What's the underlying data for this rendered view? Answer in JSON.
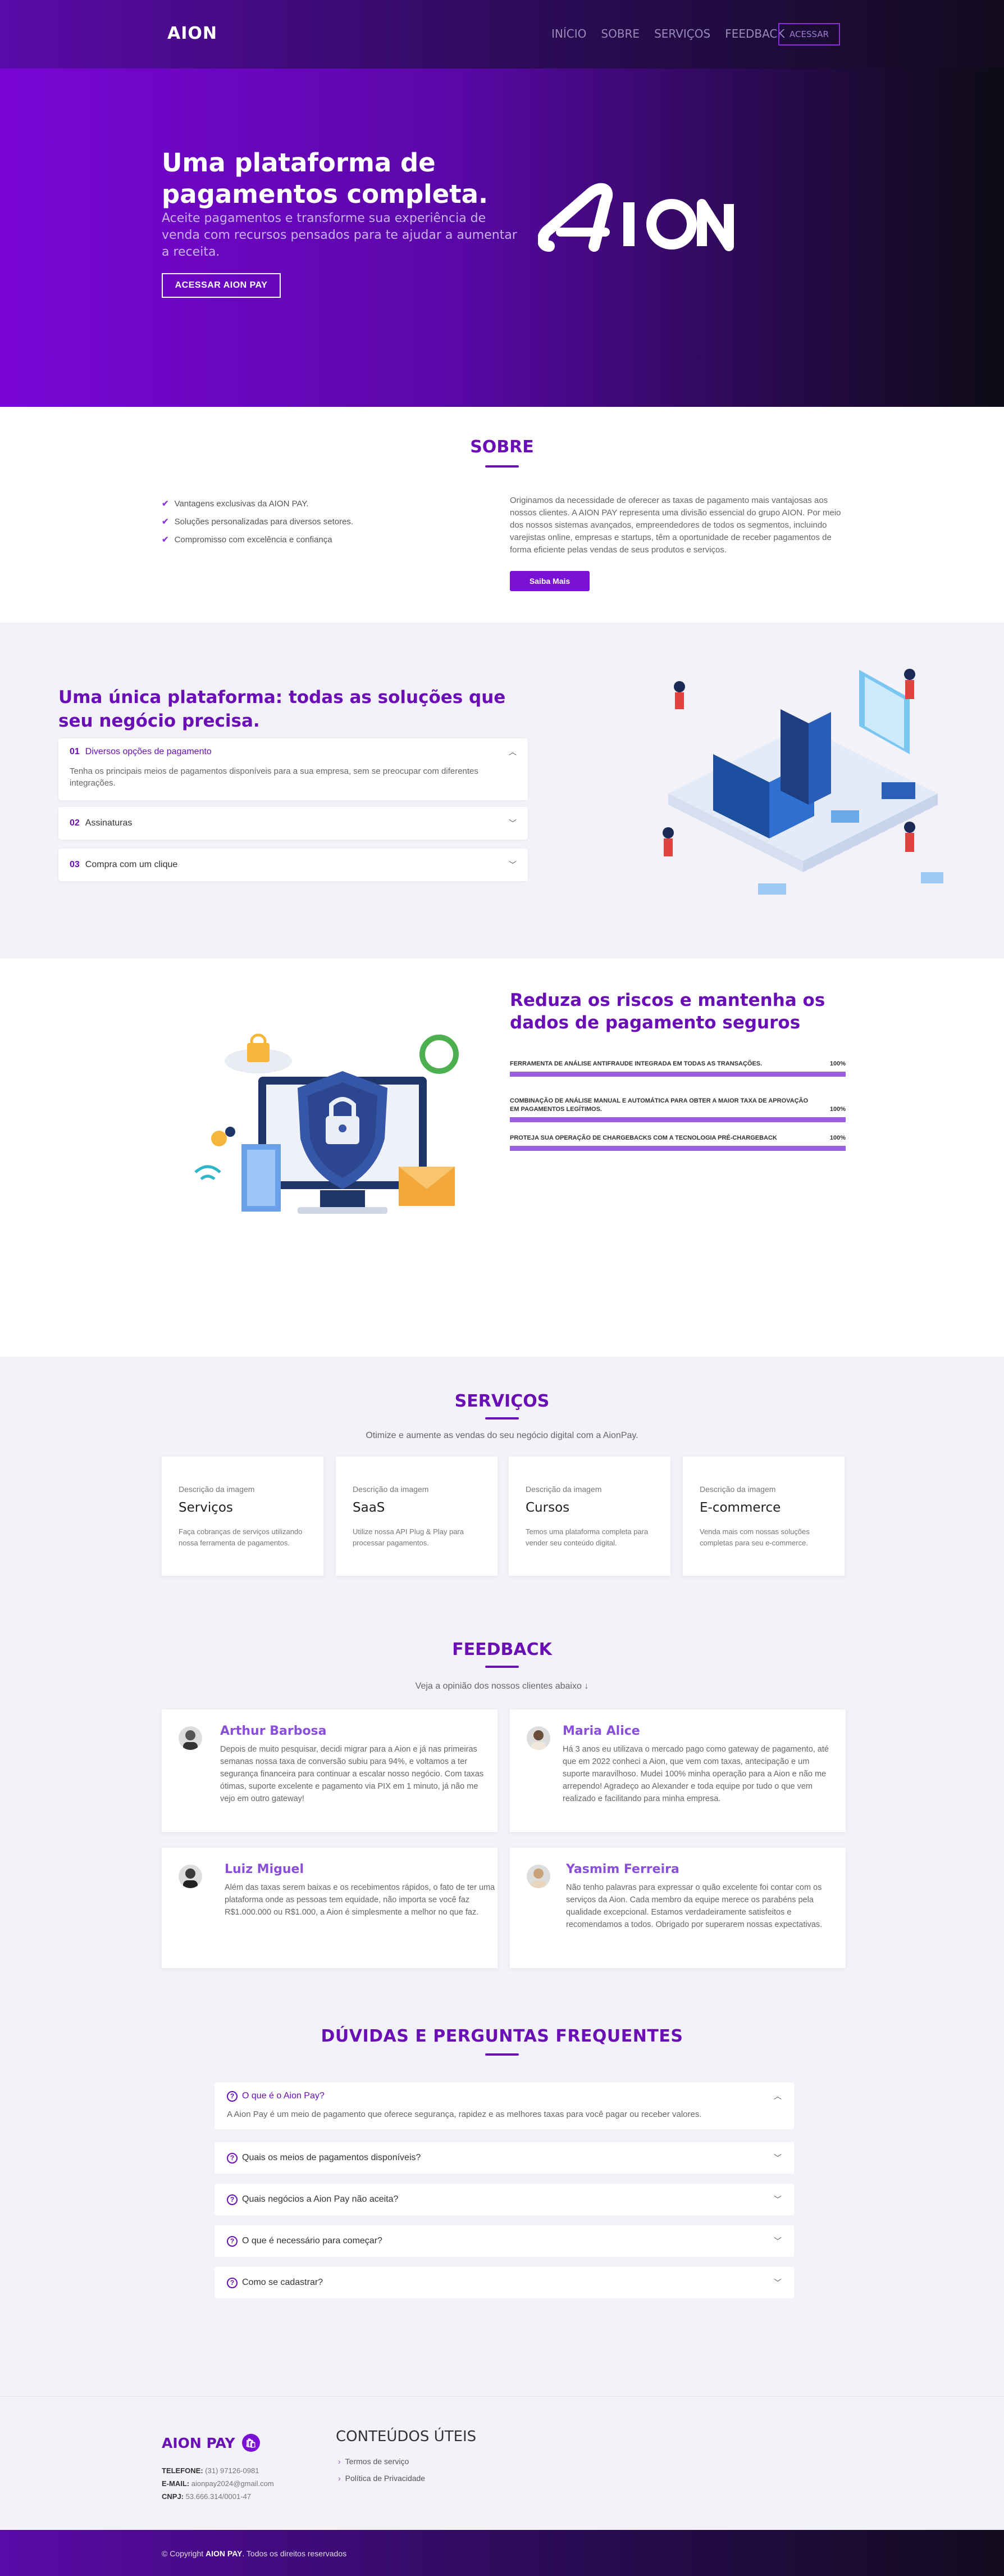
{
  "nav": {
    "logo": "AION",
    "links": [
      "INÍCIO",
      "SOBRE",
      "SERVIÇOS",
      "FEEDBACK"
    ],
    "cta": "ACESSAR"
  },
  "hero": {
    "title": "Uma plataforma de pagamentos completa.",
    "subtitle": "Aceite pagamentos e transforme sua experiência de venda com recursos pensados para te ajudar a aumentar a receita.",
    "button": "ACESSAR AION PAY",
    "logo": "AION"
  },
  "sobre": {
    "title": "SOBRE",
    "checks": [
      "Vantagens exclusivas da AION PAY.",
      "Soluções personalizadas para diversos setores.",
      "Compromisso com excelência e confiança"
    ],
    "text": "Originamos da necessidade de oferecer as taxas de pagamento mais vantajosas aos nossos clientes. A AION PAY representa uma divisão essencial do grupo AION. Por meio dos nossos sistemas avançados, empreendedores de todos os segmentos, incluindo varejistas online, empresas e startups, têm a oportunidade de receber pagamentos de forma eficiente pelas vendas de seus produtos e serviços.",
    "button": "Saiba Mais"
  },
  "plataforma": {
    "title": "Uma única plataforma: todas as soluções que seu negócio precisa.",
    "items": [
      {
        "num": "01",
        "label": "Diversos opções de pagamento",
        "body": "Tenha os principais meios de pagamentos disponíveis para a sua empresa, sem se preocupar com diferentes integrações."
      },
      {
        "num": "02",
        "label": "Assinaturas"
      },
      {
        "num": "03",
        "label": "Compra com um clique"
      }
    ]
  },
  "riscos": {
    "title": "Reduza os riscos e mantenha os dados de pagamento seguros",
    "bars": [
      {
        "label": "FERRAMENTA DE ANÁLISE ANTIFRAUDE INTEGRADA EM TODAS AS TRANSAÇÕES.",
        "value": "100%",
        "pct": 100
      },
      {
        "label": "COMBINAÇÃO DE ANÁLISE MANUAL E AUTOMÁTICA PARA OBTER A MAIOR TAXA DE APROVAÇÃO EM PAGAMENTOS LEGÍTIMOS.",
        "value": "100%",
        "pct": 100
      },
      {
        "label": "PROTEJA SUA OPERAÇÃO DE CHARGEBACKS COM A TECNOLOGIA PRÉ-CHARGEBACK",
        "value": "100%",
        "pct": 100
      }
    ]
  },
  "servicos": {
    "title": "SERVIÇOS",
    "subtitle": "Otimize e aumente as vendas do seu negócio digital com a AionPay.",
    "img_alt": "Descrição da imagem",
    "cards": [
      {
        "name": "Serviços",
        "desc": "Faça cobranças de serviços utilizando nossa ferramenta de pagamentos."
      },
      {
        "name": "SaaS",
        "desc": "Utilize nossa API Plug & Play para processar pagamentos."
      },
      {
        "name": "Cursos",
        "desc": "Temos uma plataforma completa para vender seu conteúdo digital."
      },
      {
        "name": "E-commerce",
        "desc": "Venda mais com nossas soluções completas para seu e-commerce."
      }
    ]
  },
  "feedback": {
    "title": "FEEDBACK",
    "subtitle": "Veja a opinião dos nossos clientes abaixo ↓",
    "items": [
      {
        "name": "Arthur Barbosa",
        "text": "Depois de muito pesquisar, decidi migrar para a Aion e já nas primeiras semanas nossa taxa de conversão subiu para 94%, e voltamos a ter segurança financeira para continuar a escalar nosso negócio. Com taxas ótimas, suporte excelente e pagamento via PIX em 1 minuto, já não me vejo em outro gateway!"
      },
      {
        "name": "Maria Alice",
        "text": "Há 3 anos eu utilizava o mercado pago como gateway de pagamento, até que em 2022 conheci a Aion, que vem com taxas, antecipação e um suporte maravilhoso. Mudei 100% minha operação para a Aion e não me arrependo! Agradeço ao Alexander e toda equipe por tudo o que vem realizado e facilitando para minha empresa."
      },
      {
        "name": "Luiz Miguel",
        "text": "Além das taxas serem baixas e os recebimentos rápidos, o fato de ter uma plataforma onde as pessoas tem equidade, não importa se você faz R$1.000.000 ou R$1.000, a Aion é simplesmente a melhor no que faz."
      },
      {
        "name": "Yasmim Ferreira",
        "text": "Não tenho palavras para expressar o quão excelente foi contar com os serviços da Aion. Cada membro da equipe merece os parabéns pela qualidade excepcional. Estamos verdadeiramente satisfeitos e recomendamos a todos. Obrigado por superarem nossas expectativas."
      }
    ]
  },
  "faq": {
    "title": "DÚVIDAS E PERGUNTAS FREQUENTES",
    "items": [
      {
        "q": "O que é o Aion Pay?",
        "a": "A Aion Pay é um meio de pagamento que oferece segurança, rapidez e as melhores taxas para você pagar ou receber valores."
      },
      {
        "q": "Quais os meios de pagamentos disponíveis?"
      },
      {
        "q": "Quais negócios a Aion Pay não aceita?"
      },
      {
        "q": "O que é necessário para começar?"
      },
      {
        "q": "Como se cadastrar?"
      }
    ]
  },
  "footer": {
    "brand": "AION PAY",
    "phone_label": "TELEFONE:",
    "phone": "(31) 97126-0981",
    "email_label": "E-MAIL:",
    "email": "aionpay2024@gmail.com",
    "cnpj_label": "CNPJ:",
    "cnpj": "53.666.314/0001-47",
    "useful_title": "CONTEÚDOS ÚTEIS",
    "links": [
      "Termos de serviço",
      "Política de Privacidade"
    ],
    "copyright_prefix": "© Copyright",
    "copyright_brand": "AION PAY",
    "copyright_suffix": ". Todos os direitos reservados"
  },
  "colors": {
    "primary": "#6a0fb5",
    "accent": "#7a12d6",
    "bar": "#9a5fe0"
  }
}
